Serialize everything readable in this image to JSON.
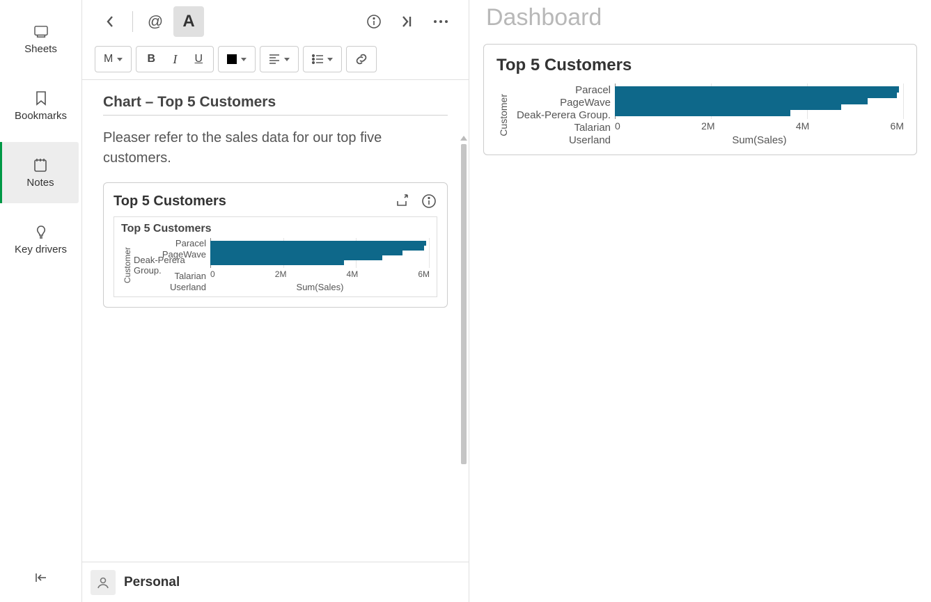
{
  "sidebar": {
    "items": [
      {
        "label": "Sheets"
      },
      {
        "label": "Bookmarks"
      },
      {
        "label": "Notes"
      },
      {
        "label": "Key drivers"
      }
    ]
  },
  "toolbar": {
    "heading_label": "M"
  },
  "note": {
    "section_title": "Chart – Top 5 Customers",
    "body": "Pleaser refer to the sales data for our top five customers.",
    "card_title": "Top 5 Customers",
    "inner_title": "Top 5 Customers"
  },
  "footer": {
    "label": "Personal"
  },
  "dashboard": {
    "title": "Dashboard",
    "card_title": "Top 5 Customers"
  },
  "chart_data": {
    "type": "bar",
    "orientation": "horizontal",
    "title": "Top 5 Customers",
    "ylabel": "Customer",
    "xlabel": "Sum(Sales)",
    "x_ticks": [
      "0",
      "2M",
      "4M",
      "6M"
    ],
    "xlim": [
      0,
      6000000
    ],
    "categories": [
      "Paracel",
      "PageWave",
      "Deak-Perera Group.",
      "Talarian",
      "Userland"
    ],
    "values": [
      5900000,
      5850000,
      5250000,
      4700000,
      3650000
    ],
    "bar_color": "#0e688a"
  }
}
